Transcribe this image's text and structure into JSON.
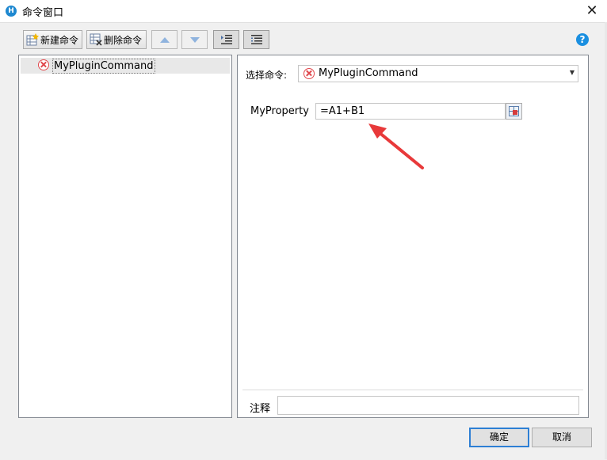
{
  "window": {
    "title": "命令窗口",
    "close": "✕"
  },
  "toolbar": {
    "new_command": "新建命令",
    "delete_command": "删除命令",
    "help": "?"
  },
  "tree": {
    "items": [
      {
        "label": "MyPluginCommand"
      }
    ]
  },
  "editor": {
    "select_label": "选择命令:",
    "selected_command": "MyPluginCommand",
    "property_name": "MyProperty",
    "property_value": "=A1+B1",
    "note_label": "注释",
    "note_value": ""
  },
  "buttons": {
    "ok": "确定",
    "cancel": "取消"
  },
  "colors": {
    "accent": "#2d7fd4",
    "error": "#e0474c",
    "annotation_arrow": "#e8393a"
  }
}
